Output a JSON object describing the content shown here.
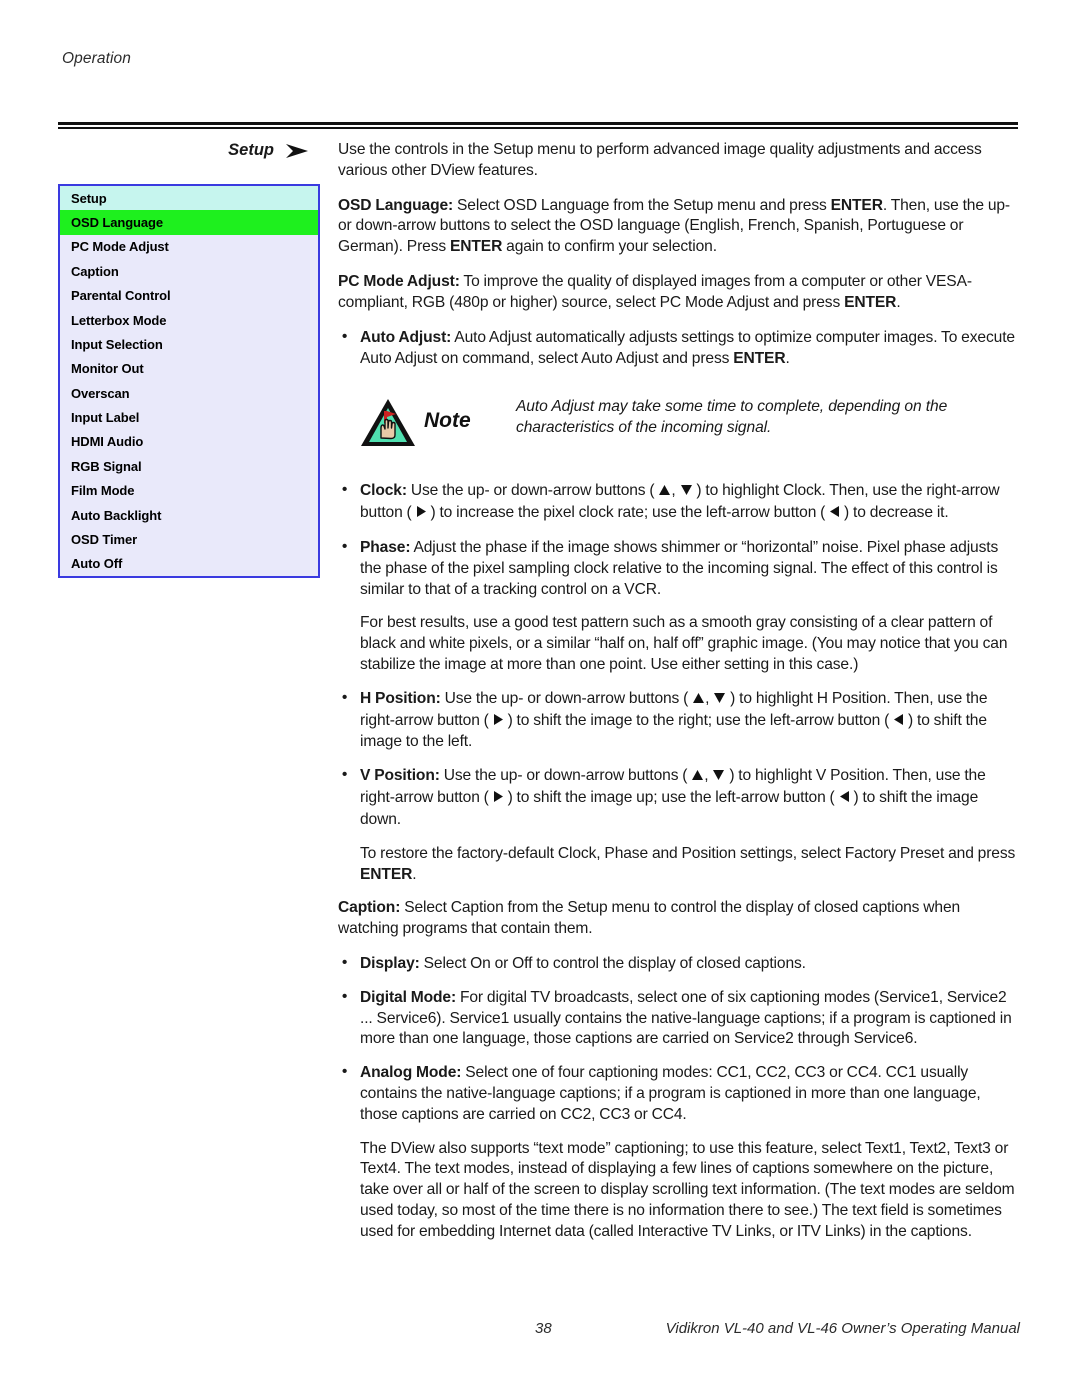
{
  "running_head": "Operation",
  "section": {
    "label": "Setup",
    "arrow_icon": "right-arrowhead-icon"
  },
  "osd_menu": {
    "title": "Setup",
    "selected": "OSD Language",
    "colors": {
      "border": "#3a3ae0",
      "background": "#e9e9fa",
      "header_background": "#c6f5ee",
      "selected_background": "#1ef01e"
    },
    "items": [
      "Setup",
      "OSD Language",
      "PC Mode Adjust",
      "Caption",
      "Parental Control",
      "Letterbox Mode",
      "Input Selection",
      "Monitor Out",
      "Overscan",
      "Input Label",
      "HDMI Audio",
      "RGB Signal",
      "Film Mode",
      "Auto Backlight",
      "OSD Timer",
      "Auto Off"
    ]
  },
  "body": {
    "intro": "Use the controls in the Setup menu to perform advanced image quality adjustments and access various other DView features.",
    "osd_language_label": "OSD Language:",
    "osd_language_text_1": " Select OSD Language from the Setup menu and press ",
    "osd_language_enter_1": "ENTER",
    "osd_language_text_2": ". Then, use the up- or down-arrow buttons to select the OSD language (English, French, Spanish, Portuguese or German). Press ",
    "osd_language_enter_2": "ENTER",
    "osd_language_text_3": " again to confirm your selection.",
    "pc_mode_label": "PC Mode Adjust:",
    "pc_mode_text_1": " To improve the quality of displayed images from a computer or other VESA-compliant, RGB (480p or higher) source, select PC Mode Adjust and press ",
    "pc_mode_enter": "ENTER",
    "pc_mode_text_2": ".",
    "auto_adjust_label": "Auto Adjust:",
    "auto_adjust_text_1": " Auto Adjust automatically adjusts settings to optimize computer images. To execute Auto Adjust on command, select Auto Adjust and press ",
    "auto_adjust_enter": "ENTER",
    "auto_adjust_text_2": ".",
    "note_word": "Note",
    "note_text": "Auto Adjust may take some time to complete, depending on the characteristics of the incoming signal.",
    "clock_label": "Clock:",
    "clock_text_1": " Use the up- or down-arrow buttons ( ",
    "clock_text_2": ", ",
    "clock_text_3": " ) to highlight Clock. Then, use the right-arrow button ( ",
    "clock_text_4": " ) to increase the pixel clock rate; use the left-arrow button ( ",
    "clock_text_5": " ) to decrease it.",
    "phase_label": "Phase:",
    "phase_text": " Adjust the phase if the image shows shimmer or “horizontal” noise. Pixel phase adjusts the phase of the pixel sampling clock relative to the incoming signal. The effect of this control is similar to that of a tracking control on a VCR.",
    "best_results": "For best results, use a good test pattern such as a smooth gray consisting of a clear pattern of black and white pixels, or a similar “half on, half off” graphic image. (You may notice that you can stabilize the image at more than one point. Use either setting in this case.)",
    "hpos_label": "H Position:",
    "hpos_text_1": " Use the up- or down-arrow buttons ( ",
    "hpos_text_2": ", ",
    "hpos_text_3": " ) to highlight H Position. Then, use the right-arrow button ( ",
    "hpos_text_4": " ) to shift the image to the right; use the left-arrow button ( ",
    "hpos_text_5": " ) to shift the image to the left.",
    "vpos_label": "V Position:",
    "vpos_text_1": " Use the up- or down-arrow buttons ( ",
    "vpos_text_2": ", ",
    "vpos_text_3": " ) to highlight V Position. Then, use the right-arrow button ( ",
    "vpos_text_4": " ) to shift the image up; use the left-arrow button ( ",
    "vpos_text_5": " ) to shift the image down.",
    "factory_text_1": "To restore the factory-default Clock, Phase and Position settings, select Factory Preset and press ",
    "factory_enter": "ENTER",
    "factory_text_2": ".",
    "caption_label": "Caption:",
    "caption_text": " Select Caption from the Setup menu to control the display of closed captions when watching programs that contain them.",
    "display_label": "Display:",
    "display_text": " Select On or Off to control the display of closed captions.",
    "digital_label": "Digital Mode:",
    "digital_text": " For digital TV broadcasts, select one of six captioning modes (Service1, Service2 ... Service6). Service1 usually contains the native-language captions; if a program is captioned in more than one language, those captions are carried on Service2 through Service6.",
    "analog_label": "Analog Mode:",
    "analog_text": " Select one of four captioning modes: CC1, CC2, CC3 or CC4. CC1 usually contains the native-language captions; if a program is captioned in more than one language, those captions are carried on CC2, CC3 or CC4.",
    "text_mode": "The DView also supports “text mode” captioning; to use this feature, select Text1, Text2, Text3 or Text4. The text modes, instead of displaying a few lines of captions somewhere on the picture, take over all or half of the screen to display scrolling text information. (The text modes are seldom used today, so most of the time there is no information there to see.) The text field is sometimes used for embedding Internet data (called Interactive TV Links, or ITV Links) in the captions."
  },
  "footer": {
    "page_number": "38",
    "manual_title": "Vidikron VL-40 and VL-46 Owner’s Operating Manual"
  }
}
